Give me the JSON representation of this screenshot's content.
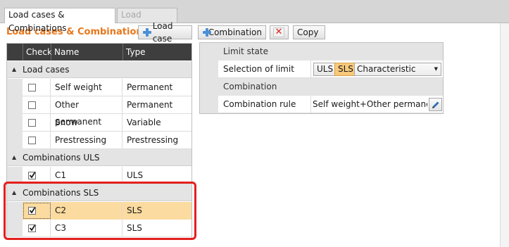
{
  "tabs": [
    {
      "label": "Load cases & Combinations",
      "active": true
    },
    {
      "label": "Load impulses",
      "active": false
    }
  ],
  "toolbar": {
    "title": "Load cases & Combinations",
    "add_load_case": "Load case",
    "add_combination": "Combination",
    "delete_icon": "x-icon",
    "copy": "Copy"
  },
  "grid": {
    "columns": [
      "Check",
      "Name",
      "Type"
    ],
    "groups": [
      {
        "label": "Load cases",
        "rows": [
          {
            "checked": false,
            "name": "Self weight",
            "type": "Permanent"
          },
          {
            "checked": false,
            "name": "Other permanent",
            "type": "Permanent"
          },
          {
            "checked": false,
            "name": "Snow",
            "type": "Variable"
          },
          {
            "checked": false,
            "name": "Prestressing",
            "type": "Prestressing"
          }
        ]
      },
      {
        "label": "Combinations ULS",
        "rows": [
          {
            "checked": true,
            "name": "C1",
            "type": "ULS"
          }
        ]
      },
      {
        "label": "Combinations SLS",
        "rows": [
          {
            "checked": true,
            "name": "C2",
            "type": "SLS",
            "selected": true
          },
          {
            "checked": true,
            "name": "C3",
            "type": "SLS"
          }
        ]
      }
    ]
  },
  "properties": {
    "limit_state_category": "Limit state",
    "selection_label": "Selection of limit state",
    "uls_option": "ULS",
    "sls_option": "SLS",
    "selected_option": "SLS",
    "characteristic_value": "Characteristic",
    "combination_category": "Combination",
    "rule_label": "Combination rule",
    "rule_value": "Self weight+Other permanen..."
  },
  "colors": {
    "accent_orange": "#e8771c",
    "selection": "#fbdb9f",
    "highlight_red": "#e3201d",
    "header_dark": "#3e3e3e"
  }
}
